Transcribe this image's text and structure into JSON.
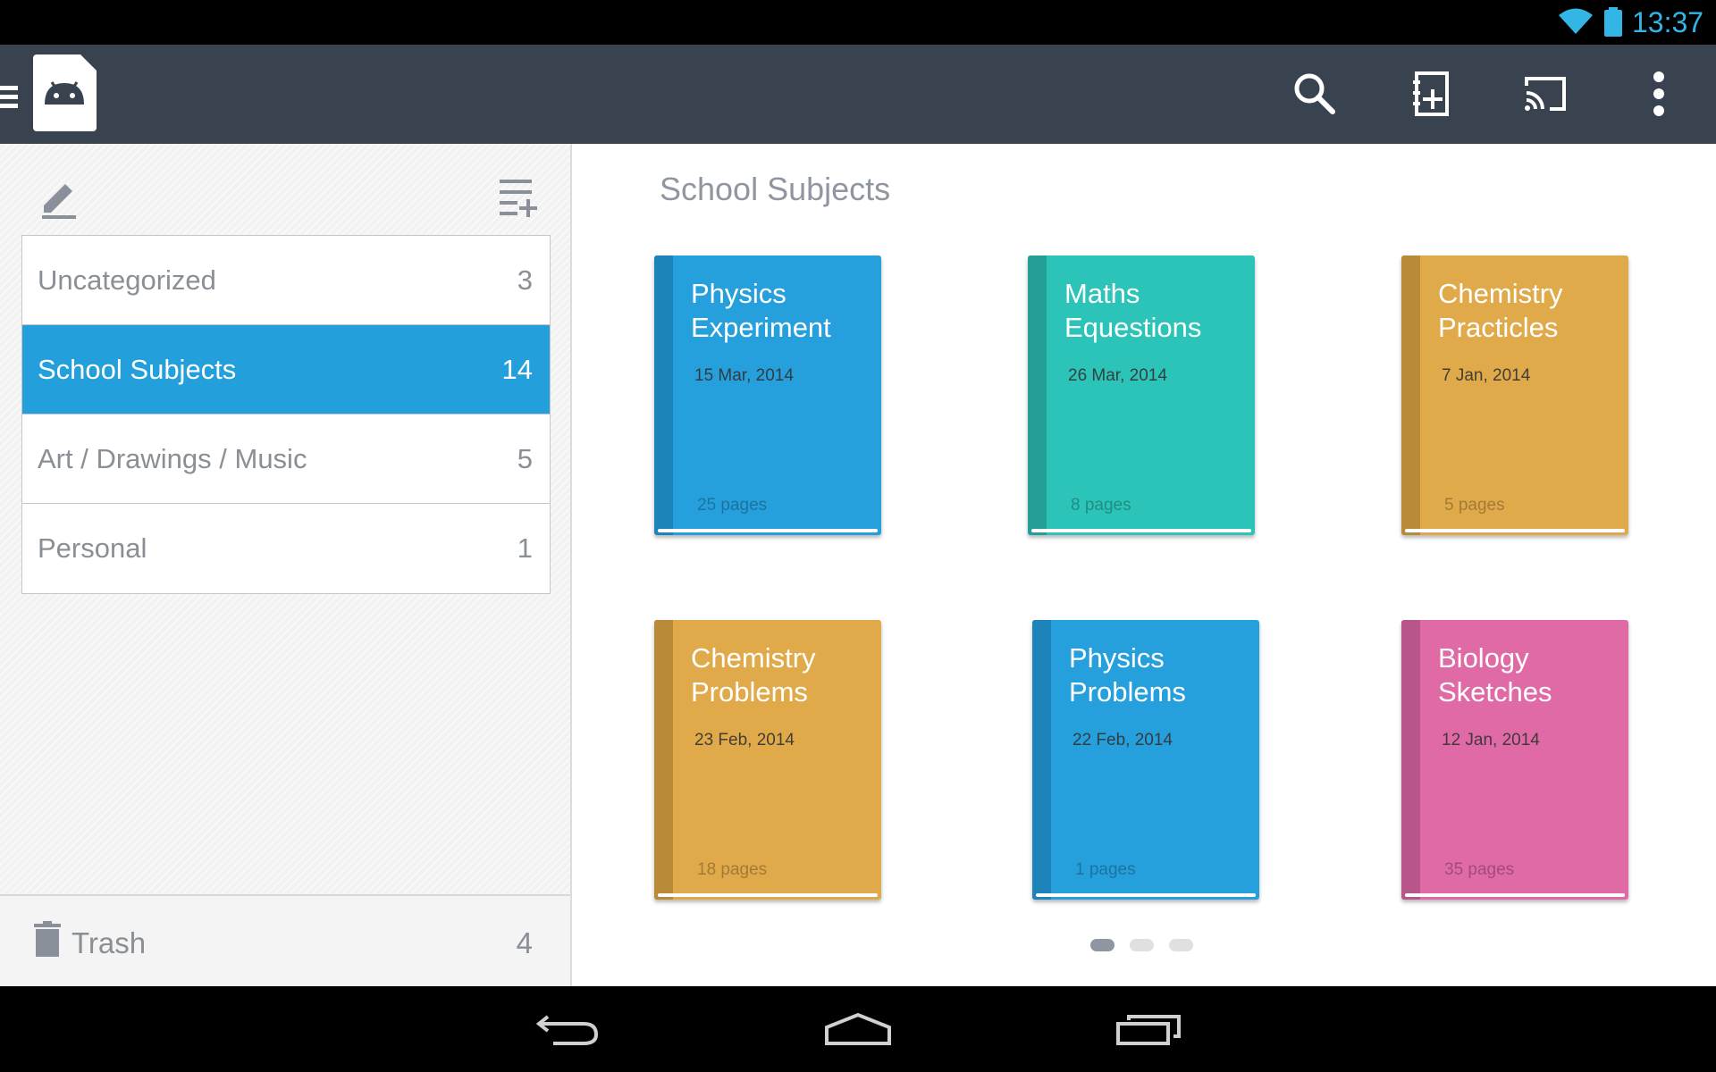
{
  "status_bar": {
    "time": "13:37",
    "icons": [
      "wifi-icon",
      "battery-icon"
    ],
    "accent_color": "#33b5e5"
  },
  "app_bar": {
    "background": "#38434f",
    "actions": [
      "search-icon",
      "new-notebook-icon",
      "cast-icon",
      "overflow-menu-icon"
    ]
  },
  "sidebar": {
    "tools": [
      "edit-icon",
      "add-category-icon"
    ],
    "categories": [
      {
        "label": "Uncategorized",
        "count": "3",
        "selected": false
      },
      {
        "label": "School Subjects",
        "count": "14",
        "selected": true
      },
      {
        "label": "Art / Drawings / Music",
        "count": "5",
        "selected": false
      },
      {
        "label": "Personal",
        "count": "1",
        "selected": false
      }
    ],
    "selected_color": "#239fdb",
    "trash": {
      "label": "Trash",
      "count": "4"
    }
  },
  "main": {
    "section_title": "School Subjects",
    "notebooks": [
      {
        "title": "Physics Experiment",
        "date": "15 Mar, 2014",
        "pages": "25 pages",
        "color": "#26a0dc",
        "spine": "#1d84b9"
      },
      {
        "title": "Maths Equestions",
        "date": "26 Mar, 2014",
        "pages": "8 pages",
        "color": "#2cc4b8",
        "spine": "#239f96"
      },
      {
        "title": "Chemistry Practicles",
        "date": "7 Jan, 2014",
        "pages": "5 pages",
        "color": "#e0aa4a",
        "spine": "#b98a38"
      },
      {
        "title": "Chemistry Problems",
        "date": "23 Feb, 2014",
        "pages": "18 pages",
        "color": "#e0aa4a",
        "spine": "#b98a38"
      },
      {
        "title": "Physics Problems",
        "date": "22 Feb, 2014",
        "pages": "1 pages",
        "color": "#26a0dc",
        "spine": "#1d84b9"
      },
      {
        "title": "Biology Sketches",
        "date": "12 Jan, 2014",
        "pages": "35 pages",
        "color": "#e06aa6",
        "spine": "#b8568a"
      }
    ],
    "pager": {
      "total": 3,
      "current": 1
    }
  },
  "nav_bar": {
    "buttons": [
      "back-icon",
      "home-icon",
      "recent-apps-icon"
    ]
  }
}
